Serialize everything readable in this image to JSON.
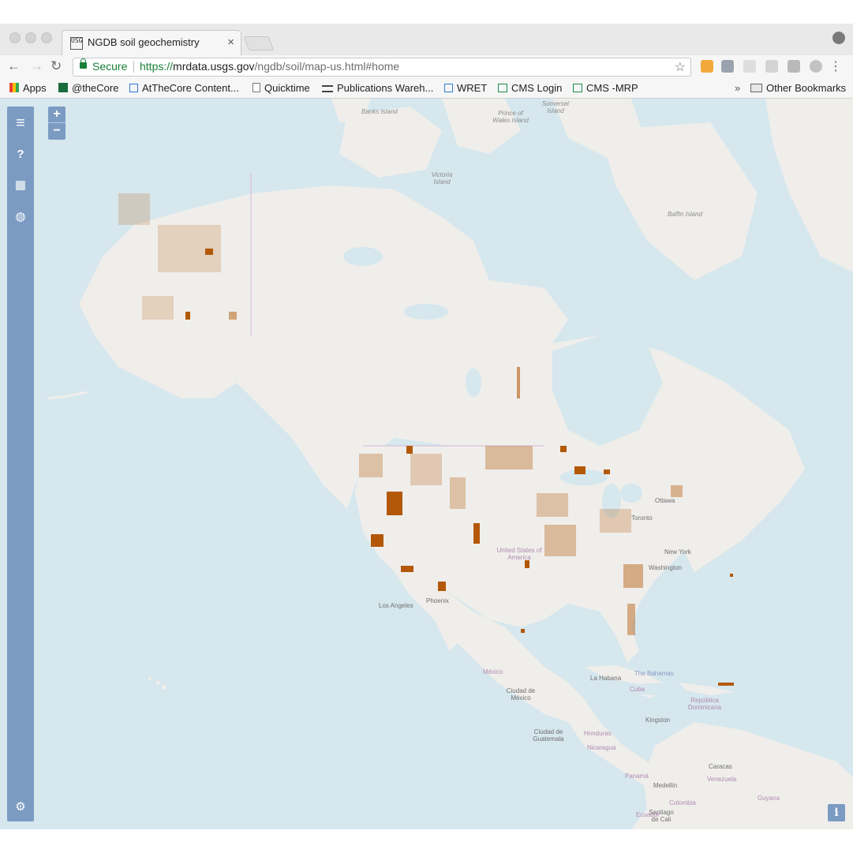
{
  "browser": {
    "tab_title": "NGDB soil geochemistry",
    "tab_close": "×",
    "favicon_text": "USGS",
    "back": "←",
    "forward": "→",
    "reload": "↻",
    "secure_label": "Secure",
    "url_scheme": "https://",
    "url_host": "mrdata.usgs.gov",
    "url_path": "/ngdb/soil/map-us.html#home",
    "star": "☆",
    "menu": "⋮"
  },
  "bookmarks": {
    "items": [
      {
        "label": "Apps"
      },
      {
        "label": "@theCore"
      },
      {
        "label": "AtTheCore Content..."
      },
      {
        "label": "Quicktime"
      },
      {
        "label": "Publications Wareh..."
      },
      {
        "label": "WRET"
      },
      {
        "label": "CMS Login"
      },
      {
        "label": "CMS -MRP"
      }
    ],
    "overflow": "»",
    "other": "Other Bookmarks"
  },
  "map": {
    "zoom_in": "+",
    "zoom_out": "−",
    "info": "i",
    "sidebar": {
      "menu": "≡",
      "help": "?",
      "table": "▦",
      "globe": "◍",
      "settings": "⚙"
    },
    "colors": {
      "water": "#d6e7ee",
      "land": "#efeeeb",
      "samples": "#b35806",
      "ui": "#7b9bc2"
    },
    "labels": {
      "banks_island": "Banks Island",
      "prince_of_wales": "Prince of Wales Island",
      "somerset": "Somerset Island",
      "victoria_island": "Victoria Island",
      "baffin_island": "Baffin Island",
      "ottawa": "Ottawa",
      "toronto": "Toronto",
      "usa": "United States of America",
      "new_york": "New York",
      "washington": "Washington",
      "los_angeles": "Los Angeles",
      "phoenix": "Phoenix",
      "mexico": "México",
      "mexico_city": "Ciudad de México",
      "la_habana": "La Habana",
      "cuba": "Cuba",
      "bahamas": "The Bahamas",
      "dominicana": "República Dominicana",
      "kingston": "Kingston",
      "guatemala": "Ciudad de Guatemala",
      "honduras": "Honduras",
      "nicaragua": "Nicaragua",
      "panama": "Panamá",
      "caracas": "Caracas",
      "venezuela": "Venezuela",
      "medellin": "Medellín",
      "colombia": "Colombia",
      "santiago_de_cali": "Santiago de Cali",
      "guyana": "Guyana",
      "ecuador": "Ecuador"
    }
  }
}
